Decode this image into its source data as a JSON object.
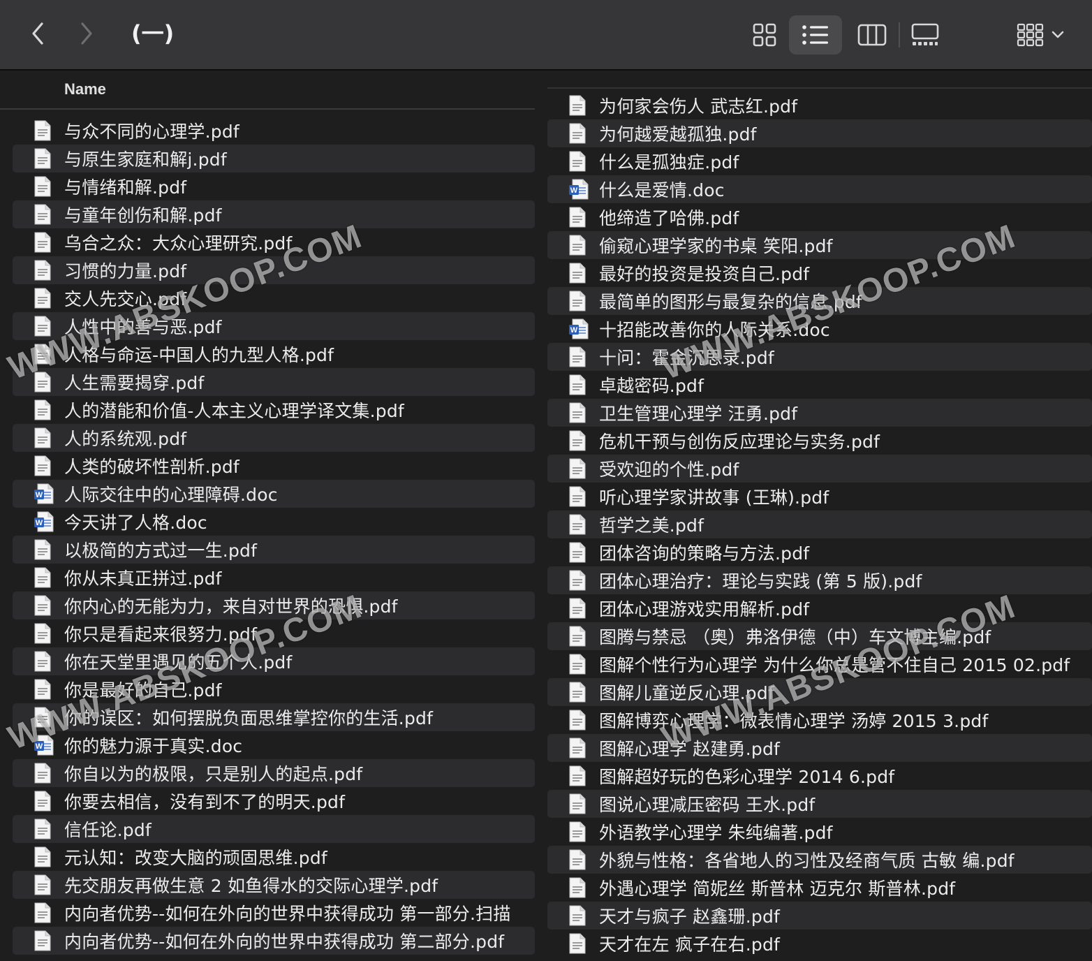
{
  "toolbar": {
    "title": "(一)",
    "back_icon": "chevron-left-icon",
    "forward_icon": "chevron-right-icon",
    "view_modes": [
      "icons",
      "list",
      "columns",
      "gallery"
    ],
    "active_view": "list",
    "group_icon": "group-grid-icon"
  },
  "list_header": {
    "name": "Name"
  },
  "left_files": [
    {
      "name": "与众不同的心理学.pdf",
      "type": "pdf"
    },
    {
      "name": "与原生家庭和解j.pdf",
      "type": "pdf"
    },
    {
      "name": "与情绪和解.pdf",
      "type": "pdf"
    },
    {
      "name": "与童年创伤和解.pdf",
      "type": "pdf"
    },
    {
      "name": "乌合之众：大众心理研究.pdf",
      "type": "pdf"
    },
    {
      "name": "习惯的力量.pdf",
      "type": "pdf"
    },
    {
      "name": "交人先交心.pdf",
      "type": "pdf"
    },
    {
      "name": "人性中的善与恶.pdf",
      "type": "pdf"
    },
    {
      "name": "人格与命运-中国人的九型人格.pdf",
      "type": "pdf"
    },
    {
      "name": "人生需要揭穿.pdf",
      "type": "pdf"
    },
    {
      "name": "人的潜能和价值-人本主义心理学译文集.pdf",
      "type": "pdf"
    },
    {
      "name": "人的系统观.pdf",
      "type": "pdf"
    },
    {
      "name": "人类的破坏性剖析.pdf",
      "type": "pdf"
    },
    {
      "name": "人际交往中的心理障碍.doc",
      "type": "doc"
    },
    {
      "name": "今天讲了人格.doc",
      "type": "doc"
    },
    {
      "name": "以极简的方式过一生.pdf",
      "type": "pdf"
    },
    {
      "name": "你从未真正拼过.pdf",
      "type": "pdf"
    },
    {
      "name": "你内心的无能为力，来自对世界的恐惧.pdf",
      "type": "pdf"
    },
    {
      "name": "你只是看起来很努力.pdf",
      "type": "pdf"
    },
    {
      "name": "你在天堂里遇见的五个人.pdf",
      "type": "pdf"
    },
    {
      "name": "你是最好的自己.pdf",
      "type": "pdf"
    },
    {
      "name": "你的误区：如何摆脱负面思维掌控你的生活.pdf",
      "type": "pdf"
    },
    {
      "name": "你的魅力源于真实.doc",
      "type": "doc"
    },
    {
      "name": "你自以为的极限，只是别人的起点.pdf",
      "type": "pdf"
    },
    {
      "name": "你要去相信，没有到不了的明天.pdf",
      "type": "pdf"
    },
    {
      "name": "信任论.pdf",
      "type": "pdf"
    },
    {
      "name": "元认知：改变大脑的顽固思维.pdf",
      "type": "pdf"
    },
    {
      "name": "先交朋友再做生意 2 如鱼得水的交际心理学.pdf",
      "type": "pdf"
    },
    {
      "name": "内向者优势--如何在外向的世界中获得成功 第一部分.扫描",
      "type": "pdf"
    },
    {
      "name": "内向者优势--如何在外向的世界中获得成功 第二部分.pdf",
      "type": "pdf"
    }
  ],
  "right_files": [
    {
      "name": "为何家会伤人 武志红.pdf",
      "type": "pdf"
    },
    {
      "name": "为何越爱越孤独.pdf",
      "type": "pdf"
    },
    {
      "name": "什么是孤独症.pdf",
      "type": "pdf"
    },
    {
      "name": "什么是爱情.doc",
      "type": "doc"
    },
    {
      "name": "他缔造了哈佛.pdf",
      "type": "pdf"
    },
    {
      "name": "偷窥心理学家的书桌 笑阳.pdf",
      "type": "pdf"
    },
    {
      "name": "最好的投资是投资自己.pdf",
      "type": "pdf"
    },
    {
      "name": "最简单的图形与最复杂的信息.pdf",
      "type": "pdf"
    },
    {
      "name": "十招能改善你的人际关系.doc",
      "type": "doc"
    },
    {
      "name": "十问：霍金沉思录.pdf",
      "type": "pdf"
    },
    {
      "name": "卓越密码.pdf",
      "type": "pdf"
    },
    {
      "name": "卫生管理心理学 汪勇.pdf",
      "type": "pdf"
    },
    {
      "name": "危机干预与创伤反应理论与实务.pdf",
      "type": "pdf"
    },
    {
      "name": "受欢迎的个性.pdf",
      "type": "pdf"
    },
    {
      "name": "听心理学家讲故事 (王琳).pdf",
      "type": "pdf"
    },
    {
      "name": "哲学之美.pdf",
      "type": "pdf"
    },
    {
      "name": "团体咨询的策略与方法.pdf",
      "type": "pdf"
    },
    {
      "name": "团体心理治疗：理论与实践 (第 5 版).pdf",
      "type": "pdf"
    },
    {
      "name": "团体心理游戏实用解析.pdf",
      "type": "pdf"
    },
    {
      "name": "图腾与禁忌 （奥）弗洛伊德（中）车文博主编.pdf",
      "type": "pdf"
    },
    {
      "name": "图解个性行为心理学 为什么你总是管不住自己 2015 02.pdf",
      "type": "pdf"
    },
    {
      "name": "图解儿童逆反心理.pdf",
      "type": "pdf"
    },
    {
      "name": "图解博弈心理学：微表情心理学 汤婷 2015 3.pdf",
      "type": "pdf"
    },
    {
      "name": "图解心理学 赵建勇.pdf",
      "type": "pdf"
    },
    {
      "name": "图解超好玩的色彩心理学 2014 6.pdf",
      "type": "pdf"
    },
    {
      "name": "图说心理减压密码 王水.pdf",
      "type": "pdf"
    },
    {
      "name": "外语教学心理学 朱纯编著.pdf",
      "type": "pdf"
    },
    {
      "name": "外貌与性格：各省地人的习性及经商气质 古敏 编.pdf",
      "type": "pdf"
    },
    {
      "name": "外遇心理学 简妮丝 斯普林 迈克尔 斯普林.pdf",
      "type": "pdf"
    },
    {
      "name": "天才与疯子 赵鑫珊.pdf",
      "type": "pdf"
    },
    {
      "name": "天才在左 疯子在右.pdf",
      "type": "pdf"
    }
  ],
  "watermark": "WWW.ABSKOOP.COM",
  "colors": {
    "toolbar_bg": "#363638",
    "list_bg": "#1e1e1e",
    "row_alt": "#2c2c2e",
    "text": "#ececec",
    "active_view_bg": "#4a4a4c",
    "doc_blue": "#2b5fb8"
  }
}
